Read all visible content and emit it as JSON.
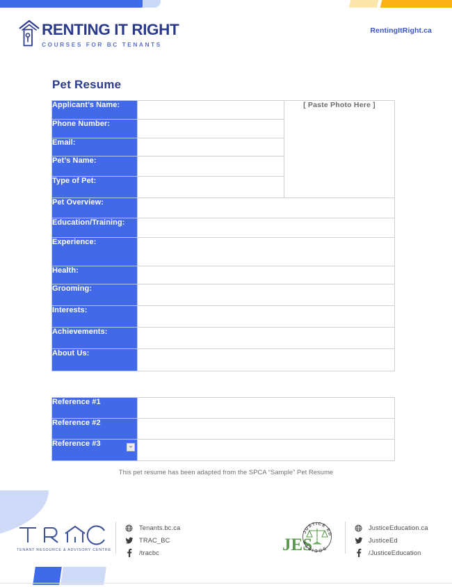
{
  "header": {
    "brand_title": "RENTING IT RIGHT",
    "brand_subtitle": "COURSES FOR BC TENANTS",
    "brand_icon": "house-door-icon",
    "site_link": "RentingItRight.ca"
  },
  "document": {
    "title": "Pet Resume",
    "footnote": "This pet resume has been adapted from the SPCA “Sample” Pet Resume",
    "photo_placeholder": "[ Paste Photo Here ]"
  },
  "main_table": {
    "rows": [
      {
        "label": "Applicant’s Name:",
        "value": ""
      },
      {
        "label": "Phone Number:",
        "value": ""
      },
      {
        "label": "Email:",
        "value": ""
      },
      {
        "label": "Pet’s Name:",
        "value": ""
      },
      {
        "label": "Type of Pet:",
        "value": ""
      },
      {
        "label": "Pet Overview:",
        "value": ""
      },
      {
        "label": "Education/Training:",
        "value": ""
      },
      {
        "label": "Experience:",
        "value": ""
      },
      {
        "label": "Health:",
        "value": ""
      },
      {
        "label": "Grooming:",
        "value": ""
      },
      {
        "label": "Interests:",
        "value": ""
      },
      {
        "label": "Achievements:",
        "value": ""
      },
      {
        "label": "About Us:",
        "value": ""
      }
    ]
  },
  "reference_table": {
    "rows": [
      {
        "label": "Reference #1",
        "value": ""
      },
      {
        "label": "Reference #2",
        "value": ""
      },
      {
        "label": "Reference #3",
        "value": ""
      }
    ]
  },
  "footer": {
    "trac": {
      "wordmark": "TRAC",
      "tagline": "TENANT RESOURCE & ADVISORY CENTRE",
      "links": [
        {
          "icon": "globe-icon",
          "label": "Tenants.bc.ca"
        },
        {
          "icon": "twitter-icon",
          "label": "TRAC_BC"
        },
        {
          "icon": "facebook-icon",
          "label": "/tracbc"
        }
      ]
    },
    "jes": {
      "wordmark": "JES",
      "seal_text_top": "JUSTICE EDUCATION",
      "seal_text_bottom": "SOCIETY",
      "seal_icon": "scales-of-justice-icon",
      "links": [
        {
          "icon": "globe-icon",
          "label": "JusticeEducation.ca"
        },
        {
          "icon": "twitter-icon",
          "label": "JusticeEd"
        },
        {
          "icon": "facebook-icon",
          "label": "/JusticeEducation"
        }
      ]
    }
  },
  "colors": {
    "label_blue": "#4169e8",
    "navy": "#2b3a8c",
    "accent_yellow": "#fbb217",
    "light_blue": "#cfdaf8",
    "border_gray": "#cfcfcf"
  }
}
